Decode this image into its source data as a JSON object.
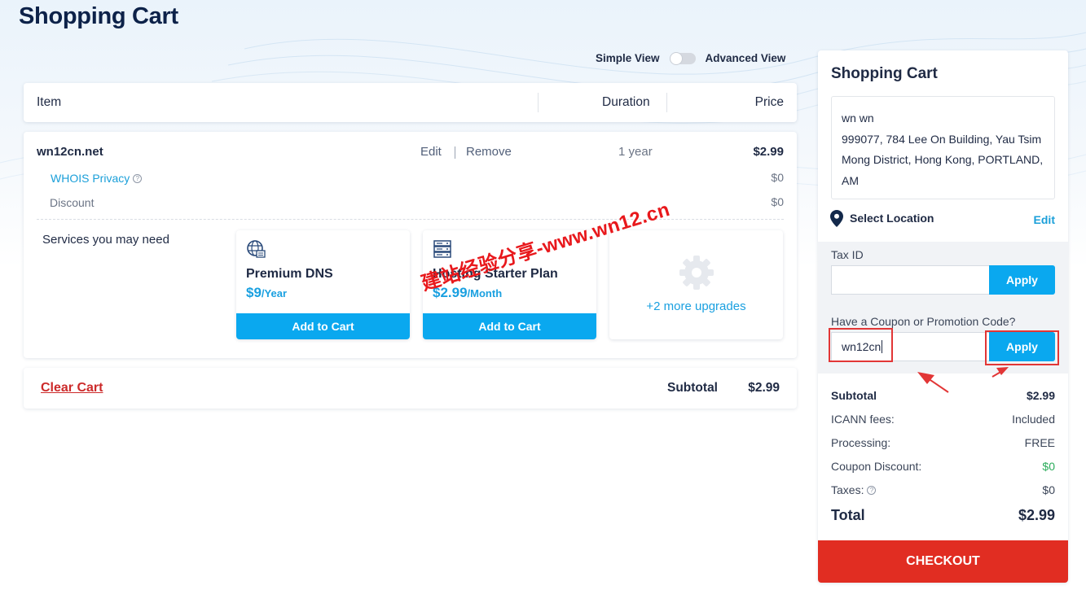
{
  "page": {
    "title": "Shopping Cart"
  },
  "view_toggle": {
    "simple_label": "Simple View",
    "advanced_label": "Advanced View"
  },
  "table_header": {
    "item": "Item",
    "duration": "Duration",
    "price": "Price"
  },
  "cart_item": {
    "domain": "wn12cn.net",
    "edit": "Edit",
    "remove": "Remove",
    "duration": "1 year",
    "price": "$2.99",
    "whois_label": "WHOIS Privacy",
    "whois_help": "?",
    "whois_price": "$0",
    "discount_label": "Discount",
    "discount_price": "$0"
  },
  "services": {
    "title": "Services you may need",
    "items": [
      {
        "name": "Premium DNS",
        "price": "$9",
        "period": "/Year",
        "button": "Add to Cart",
        "icon": "globe-dns-icon"
      },
      {
        "name": "Hosting Starter Plan",
        "price": "$2.99",
        "period": "/Month",
        "button": "Add to Cart",
        "icon": "server-icon"
      }
    ],
    "more": "+2 more upgrades",
    "more_icon": "gear-icon"
  },
  "subtotal_bar": {
    "clear_cart": "Clear Cart",
    "subtotal_label": "Subtotal",
    "subtotal_value": "$2.99"
  },
  "sidebar": {
    "title": "Shopping Cart",
    "address_lines": [
      "wn wn",
      "999077, 784 Lee On Building, Yau Tsim",
      "Mong District, Hong Kong, PORTLAND,",
      "AM"
    ],
    "select_location": "Select Location",
    "edit": "Edit",
    "tax_id_label": "Tax ID",
    "tax_id_value": "",
    "apply": "Apply",
    "coupon_label": "Have a Coupon or Promotion Code?",
    "coupon_value": "wn12cn",
    "coupon_apply": "Apply",
    "summary": {
      "subtotal_label": "Subtotal",
      "subtotal_value": "$2.99",
      "icann_label": "ICANN fees:",
      "icann_value": "Included",
      "processing_label": "Processing:",
      "processing_value": "FREE",
      "coupon_discount_label": "Coupon Discount:",
      "coupon_discount_value": "$0",
      "taxes_label": "Taxes:",
      "taxes_help": "?",
      "taxes_value": "$0",
      "total_label": "Total",
      "total_value": "$2.99"
    },
    "checkout": "CHECKOUT"
  },
  "watermark": "建站经验分享-www.wn12.cn",
  "colors": {
    "accent": "#0aa8ef",
    "link": "#1a9fd9",
    "checkout": "#e12d22",
    "green": "#2aab5a",
    "highlight": "#e23636"
  }
}
